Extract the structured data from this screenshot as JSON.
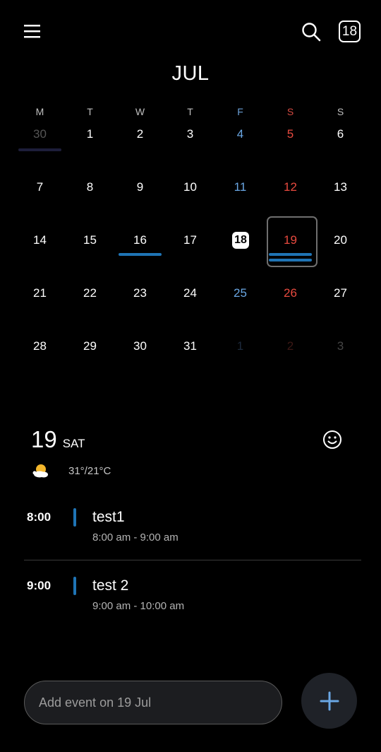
{
  "header": {
    "today_badge": "18",
    "month_title": "JUL"
  },
  "weekdays": [
    "M",
    "T",
    "W",
    "T",
    "F",
    "S",
    "S"
  ],
  "calendar": {
    "weeks": [
      [
        "30",
        "1",
        "2",
        "3",
        "4",
        "5",
        "6"
      ],
      [
        "7",
        "8",
        "9",
        "10",
        "11",
        "12",
        "13"
      ],
      [
        "14",
        "15",
        "16",
        "17",
        "18",
        "19",
        "20"
      ],
      [
        "21",
        "22",
        "23",
        "24",
        "25",
        "26",
        "27"
      ],
      [
        "28",
        "29",
        "30",
        "31",
        "1",
        "2",
        "3"
      ]
    ]
  },
  "day_detail": {
    "day_number": "19",
    "day_name": "SAT",
    "temperature": "31°/21°C"
  },
  "events": [
    {
      "time": "8:00",
      "title": "test1",
      "range": "8:00 am - 9:00 am"
    },
    {
      "time": "9:00",
      "title": "test 2",
      "range": "9:00 am - 10:00 am"
    }
  ],
  "quick_add": {
    "placeholder": "Add event on 19 Jul"
  },
  "colors": {
    "event_blue": "#1f74b5",
    "friday_blue": "#6aa7e4",
    "saturday_red": "#e84a3f"
  }
}
